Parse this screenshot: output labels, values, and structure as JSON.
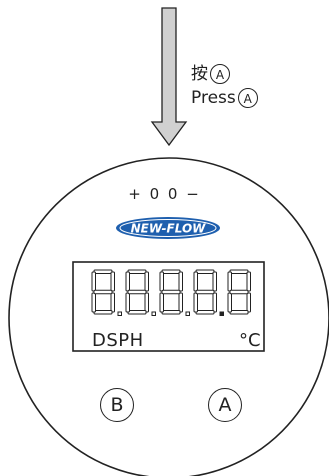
{
  "instruction": {
    "press_cn": "按",
    "press_en": "Press",
    "button_ref": "A"
  },
  "device": {
    "top_label": "+ 0 0 −",
    "logo_text": "NEW-FLOW",
    "mode_label": "DSPH",
    "unit_label": "°C",
    "button_b": "B",
    "button_a": "A"
  },
  "colors": {
    "arrow_fill": "#d0d0d0",
    "outline": "#222222",
    "logo_blue": "#1e5fae"
  }
}
